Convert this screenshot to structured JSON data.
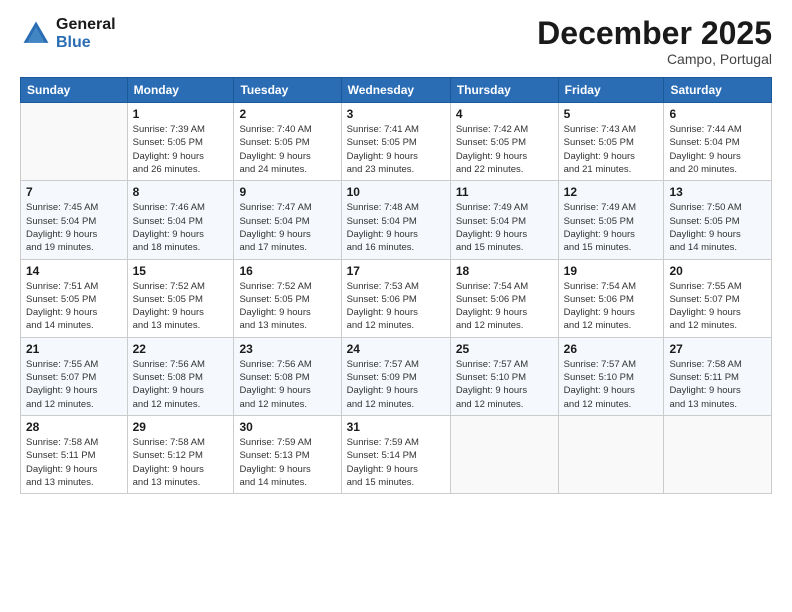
{
  "logo": {
    "line1": "General",
    "line2": "Blue"
  },
  "title": "December 2025",
  "subtitle": "Campo, Portugal",
  "days_of_week": [
    "Sunday",
    "Monday",
    "Tuesday",
    "Wednesday",
    "Thursday",
    "Friday",
    "Saturday"
  ],
  "weeks": [
    [
      {
        "num": "",
        "info": ""
      },
      {
        "num": "1",
        "info": "Sunrise: 7:39 AM\nSunset: 5:05 PM\nDaylight: 9 hours\nand 26 minutes."
      },
      {
        "num": "2",
        "info": "Sunrise: 7:40 AM\nSunset: 5:05 PM\nDaylight: 9 hours\nand 24 minutes."
      },
      {
        "num": "3",
        "info": "Sunrise: 7:41 AM\nSunset: 5:05 PM\nDaylight: 9 hours\nand 23 minutes."
      },
      {
        "num": "4",
        "info": "Sunrise: 7:42 AM\nSunset: 5:05 PM\nDaylight: 9 hours\nand 22 minutes."
      },
      {
        "num": "5",
        "info": "Sunrise: 7:43 AM\nSunset: 5:05 PM\nDaylight: 9 hours\nand 21 minutes."
      },
      {
        "num": "6",
        "info": "Sunrise: 7:44 AM\nSunset: 5:04 PM\nDaylight: 9 hours\nand 20 minutes."
      }
    ],
    [
      {
        "num": "7",
        "info": "Sunrise: 7:45 AM\nSunset: 5:04 PM\nDaylight: 9 hours\nand 19 minutes."
      },
      {
        "num": "8",
        "info": "Sunrise: 7:46 AM\nSunset: 5:04 PM\nDaylight: 9 hours\nand 18 minutes."
      },
      {
        "num": "9",
        "info": "Sunrise: 7:47 AM\nSunset: 5:04 PM\nDaylight: 9 hours\nand 17 minutes."
      },
      {
        "num": "10",
        "info": "Sunrise: 7:48 AM\nSunset: 5:04 PM\nDaylight: 9 hours\nand 16 minutes."
      },
      {
        "num": "11",
        "info": "Sunrise: 7:49 AM\nSunset: 5:04 PM\nDaylight: 9 hours\nand 15 minutes."
      },
      {
        "num": "12",
        "info": "Sunrise: 7:49 AM\nSunset: 5:05 PM\nDaylight: 9 hours\nand 15 minutes."
      },
      {
        "num": "13",
        "info": "Sunrise: 7:50 AM\nSunset: 5:05 PM\nDaylight: 9 hours\nand 14 minutes."
      }
    ],
    [
      {
        "num": "14",
        "info": "Sunrise: 7:51 AM\nSunset: 5:05 PM\nDaylight: 9 hours\nand 14 minutes."
      },
      {
        "num": "15",
        "info": "Sunrise: 7:52 AM\nSunset: 5:05 PM\nDaylight: 9 hours\nand 13 minutes."
      },
      {
        "num": "16",
        "info": "Sunrise: 7:52 AM\nSunset: 5:05 PM\nDaylight: 9 hours\nand 13 minutes."
      },
      {
        "num": "17",
        "info": "Sunrise: 7:53 AM\nSunset: 5:06 PM\nDaylight: 9 hours\nand 12 minutes."
      },
      {
        "num": "18",
        "info": "Sunrise: 7:54 AM\nSunset: 5:06 PM\nDaylight: 9 hours\nand 12 minutes."
      },
      {
        "num": "19",
        "info": "Sunrise: 7:54 AM\nSunset: 5:06 PM\nDaylight: 9 hours\nand 12 minutes."
      },
      {
        "num": "20",
        "info": "Sunrise: 7:55 AM\nSunset: 5:07 PM\nDaylight: 9 hours\nand 12 minutes."
      }
    ],
    [
      {
        "num": "21",
        "info": "Sunrise: 7:55 AM\nSunset: 5:07 PM\nDaylight: 9 hours\nand 12 minutes."
      },
      {
        "num": "22",
        "info": "Sunrise: 7:56 AM\nSunset: 5:08 PM\nDaylight: 9 hours\nand 12 minutes."
      },
      {
        "num": "23",
        "info": "Sunrise: 7:56 AM\nSunset: 5:08 PM\nDaylight: 9 hours\nand 12 minutes."
      },
      {
        "num": "24",
        "info": "Sunrise: 7:57 AM\nSunset: 5:09 PM\nDaylight: 9 hours\nand 12 minutes."
      },
      {
        "num": "25",
        "info": "Sunrise: 7:57 AM\nSunset: 5:10 PM\nDaylight: 9 hours\nand 12 minutes."
      },
      {
        "num": "26",
        "info": "Sunrise: 7:57 AM\nSunset: 5:10 PM\nDaylight: 9 hours\nand 12 minutes."
      },
      {
        "num": "27",
        "info": "Sunrise: 7:58 AM\nSunset: 5:11 PM\nDaylight: 9 hours\nand 13 minutes."
      }
    ],
    [
      {
        "num": "28",
        "info": "Sunrise: 7:58 AM\nSunset: 5:11 PM\nDaylight: 9 hours\nand 13 minutes."
      },
      {
        "num": "29",
        "info": "Sunrise: 7:58 AM\nSunset: 5:12 PM\nDaylight: 9 hours\nand 13 minutes."
      },
      {
        "num": "30",
        "info": "Sunrise: 7:59 AM\nSunset: 5:13 PM\nDaylight: 9 hours\nand 14 minutes."
      },
      {
        "num": "31",
        "info": "Sunrise: 7:59 AM\nSunset: 5:14 PM\nDaylight: 9 hours\nand 15 minutes."
      },
      {
        "num": "",
        "info": ""
      },
      {
        "num": "",
        "info": ""
      },
      {
        "num": "",
        "info": ""
      }
    ]
  ]
}
